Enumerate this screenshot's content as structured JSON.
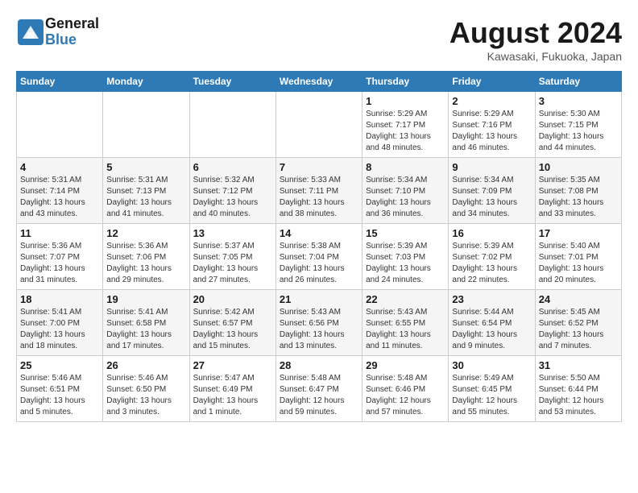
{
  "header": {
    "logo_general": "General",
    "logo_blue": "Blue",
    "month_title": "August 2024",
    "location": "Kawasaki, Fukuoka, Japan"
  },
  "weekdays": [
    "Sunday",
    "Monday",
    "Tuesday",
    "Wednesday",
    "Thursday",
    "Friday",
    "Saturday"
  ],
  "weeks": [
    [
      {
        "day": "",
        "info": ""
      },
      {
        "day": "",
        "info": ""
      },
      {
        "day": "",
        "info": ""
      },
      {
        "day": "",
        "info": ""
      },
      {
        "day": "1",
        "info": "Sunrise: 5:29 AM\nSunset: 7:17 PM\nDaylight: 13 hours\nand 48 minutes."
      },
      {
        "day": "2",
        "info": "Sunrise: 5:29 AM\nSunset: 7:16 PM\nDaylight: 13 hours\nand 46 minutes."
      },
      {
        "day": "3",
        "info": "Sunrise: 5:30 AM\nSunset: 7:15 PM\nDaylight: 13 hours\nand 44 minutes."
      }
    ],
    [
      {
        "day": "4",
        "info": "Sunrise: 5:31 AM\nSunset: 7:14 PM\nDaylight: 13 hours\nand 43 minutes."
      },
      {
        "day": "5",
        "info": "Sunrise: 5:31 AM\nSunset: 7:13 PM\nDaylight: 13 hours\nand 41 minutes."
      },
      {
        "day": "6",
        "info": "Sunrise: 5:32 AM\nSunset: 7:12 PM\nDaylight: 13 hours\nand 40 minutes."
      },
      {
        "day": "7",
        "info": "Sunrise: 5:33 AM\nSunset: 7:11 PM\nDaylight: 13 hours\nand 38 minutes."
      },
      {
        "day": "8",
        "info": "Sunrise: 5:34 AM\nSunset: 7:10 PM\nDaylight: 13 hours\nand 36 minutes."
      },
      {
        "day": "9",
        "info": "Sunrise: 5:34 AM\nSunset: 7:09 PM\nDaylight: 13 hours\nand 34 minutes."
      },
      {
        "day": "10",
        "info": "Sunrise: 5:35 AM\nSunset: 7:08 PM\nDaylight: 13 hours\nand 33 minutes."
      }
    ],
    [
      {
        "day": "11",
        "info": "Sunrise: 5:36 AM\nSunset: 7:07 PM\nDaylight: 13 hours\nand 31 minutes."
      },
      {
        "day": "12",
        "info": "Sunrise: 5:36 AM\nSunset: 7:06 PM\nDaylight: 13 hours\nand 29 minutes."
      },
      {
        "day": "13",
        "info": "Sunrise: 5:37 AM\nSunset: 7:05 PM\nDaylight: 13 hours\nand 27 minutes."
      },
      {
        "day": "14",
        "info": "Sunrise: 5:38 AM\nSunset: 7:04 PM\nDaylight: 13 hours\nand 26 minutes."
      },
      {
        "day": "15",
        "info": "Sunrise: 5:39 AM\nSunset: 7:03 PM\nDaylight: 13 hours\nand 24 minutes."
      },
      {
        "day": "16",
        "info": "Sunrise: 5:39 AM\nSunset: 7:02 PM\nDaylight: 13 hours\nand 22 minutes."
      },
      {
        "day": "17",
        "info": "Sunrise: 5:40 AM\nSunset: 7:01 PM\nDaylight: 13 hours\nand 20 minutes."
      }
    ],
    [
      {
        "day": "18",
        "info": "Sunrise: 5:41 AM\nSunset: 7:00 PM\nDaylight: 13 hours\nand 18 minutes."
      },
      {
        "day": "19",
        "info": "Sunrise: 5:41 AM\nSunset: 6:58 PM\nDaylight: 13 hours\nand 17 minutes."
      },
      {
        "day": "20",
        "info": "Sunrise: 5:42 AM\nSunset: 6:57 PM\nDaylight: 13 hours\nand 15 minutes."
      },
      {
        "day": "21",
        "info": "Sunrise: 5:43 AM\nSunset: 6:56 PM\nDaylight: 13 hours\nand 13 minutes."
      },
      {
        "day": "22",
        "info": "Sunrise: 5:43 AM\nSunset: 6:55 PM\nDaylight: 13 hours\nand 11 minutes."
      },
      {
        "day": "23",
        "info": "Sunrise: 5:44 AM\nSunset: 6:54 PM\nDaylight: 13 hours\nand 9 minutes."
      },
      {
        "day": "24",
        "info": "Sunrise: 5:45 AM\nSunset: 6:52 PM\nDaylight: 13 hours\nand 7 minutes."
      }
    ],
    [
      {
        "day": "25",
        "info": "Sunrise: 5:46 AM\nSunset: 6:51 PM\nDaylight: 13 hours\nand 5 minutes."
      },
      {
        "day": "26",
        "info": "Sunrise: 5:46 AM\nSunset: 6:50 PM\nDaylight: 13 hours\nand 3 minutes."
      },
      {
        "day": "27",
        "info": "Sunrise: 5:47 AM\nSunset: 6:49 PM\nDaylight: 13 hours\nand 1 minute."
      },
      {
        "day": "28",
        "info": "Sunrise: 5:48 AM\nSunset: 6:47 PM\nDaylight: 12 hours\nand 59 minutes."
      },
      {
        "day": "29",
        "info": "Sunrise: 5:48 AM\nSunset: 6:46 PM\nDaylight: 12 hours\nand 57 minutes."
      },
      {
        "day": "30",
        "info": "Sunrise: 5:49 AM\nSunset: 6:45 PM\nDaylight: 12 hours\nand 55 minutes."
      },
      {
        "day": "31",
        "info": "Sunrise: 5:50 AM\nSunset: 6:44 PM\nDaylight: 12 hours\nand 53 minutes."
      }
    ]
  ]
}
